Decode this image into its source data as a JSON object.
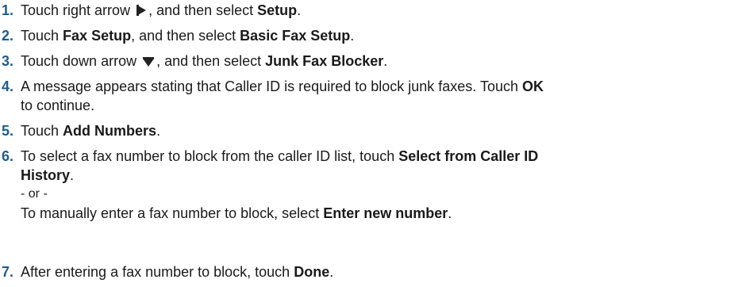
{
  "steps": [
    {
      "number": "1.",
      "touch": "Touch right arrow ",
      "icon": "right-arrow-icon",
      "after_icon": ", and then select ",
      "target": "Setup",
      "end": "."
    },
    {
      "number": "2.",
      "touch": "Touch ",
      "target1": "Fax Setup",
      "mid": ", and then select ",
      "target2": "Basic Fax Setup",
      "end": "."
    },
    {
      "number": "3.",
      "touch": "Touch down arrow ",
      "icon": "down-arrow-icon",
      "after_icon": ", and then select ",
      "target": "Junk Fax Blocker",
      "end": "."
    },
    {
      "number": "4.",
      "line1_text": "A message appears stating that Caller ID is required to block junk faxes. Touch ",
      "line1_bold": "OK",
      "line2_text": "to continue."
    },
    {
      "number": "5.",
      "touch": "Touch ",
      "target": "Add Numbers",
      "end": "."
    },
    {
      "number": "6.",
      "line1_text": "To select a fax number to block from the caller ID list, touch ",
      "line1_bold": "Select from Caller ID",
      "line2_bold": "History",
      "line2_end": ".",
      "or_text": "- or -",
      "line4_text": "To manually enter a fax number to block, select ",
      "line4_bold": "Enter new number",
      "line4_end": "."
    },
    {
      "number": "7.",
      "text": "After entering a fax number to block, touch ",
      "target": "Done",
      "end": "."
    }
  ],
  "colors": {
    "step_number": "#1f5c8b",
    "text": "#1a1a1a",
    "icon": "#222222"
  }
}
